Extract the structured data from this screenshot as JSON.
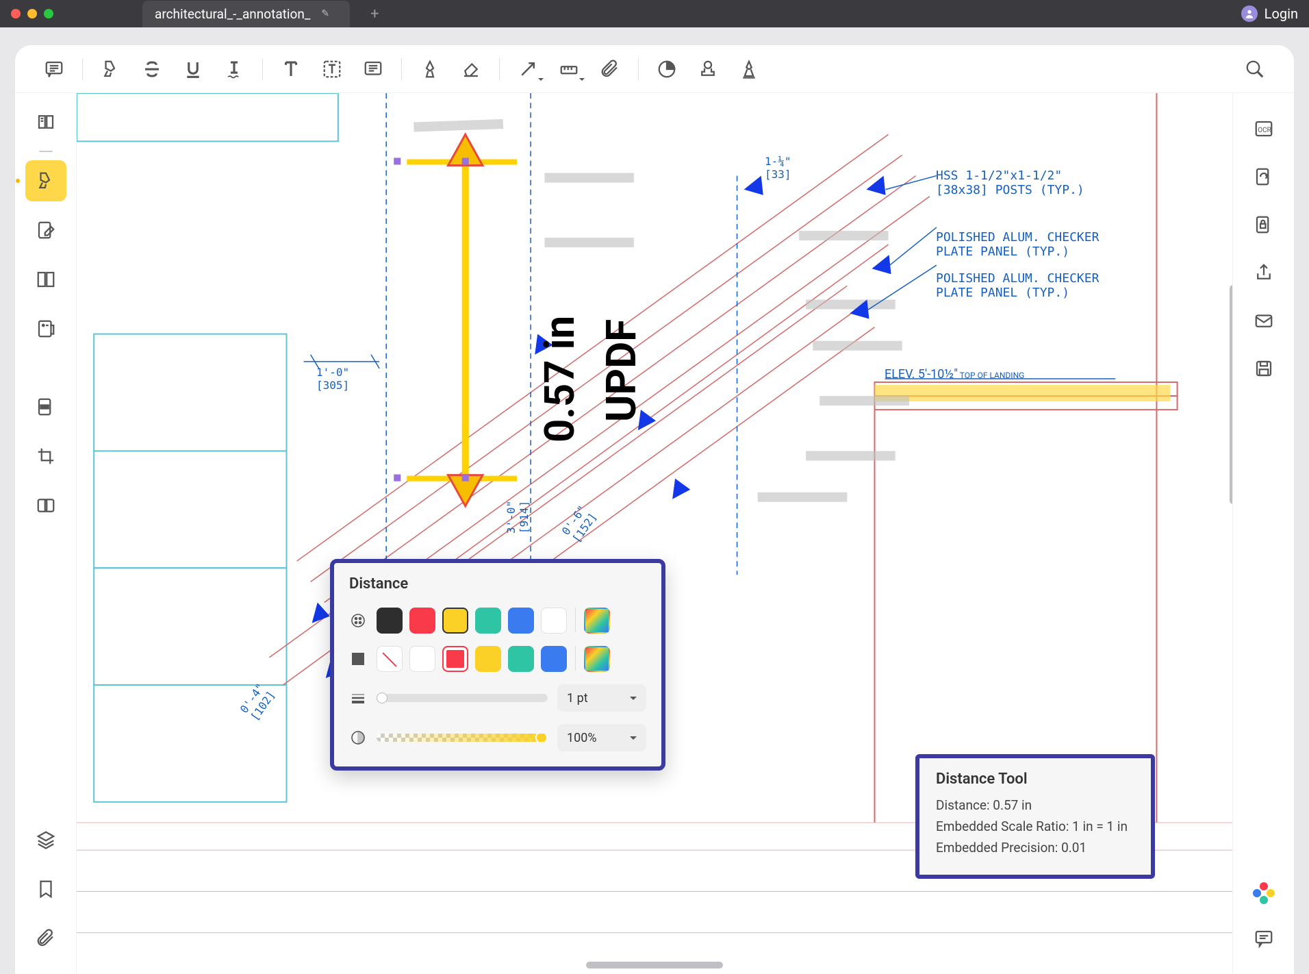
{
  "chrome": {
    "tab_title": "architectural_-_annotation_",
    "login": "Login"
  },
  "measurement": {
    "app_label": "UPDF",
    "value_label": "0.57 in"
  },
  "distance_panel": {
    "title": "Distance",
    "thickness_label": "1 pt",
    "opacity_label": "100%",
    "stroke_colors": [
      "#2e2e2e",
      "#f93a4a",
      "#fbd127",
      "#2ec4a4",
      "#3a7bf0",
      "#ffffff"
    ],
    "fill_colors": [
      "none",
      "#ffffff",
      "#f93a4a",
      "#fbd127",
      "#2ec4a4",
      "#3a7bf0"
    ]
  },
  "info_panel": {
    "title": "Distance Tool",
    "distance_line": "Distance: 0.57 in",
    "scale_line": "Embedded Scale Ratio: 1 in = 1 in",
    "precision_line": "Embedded Precision: 0.01"
  },
  "callouts": {
    "hss": "HSS 1-1/2\"x1-1/2\"\n[38x38] POSTS (TYP.)",
    "plate1": "POLISHED ALUM. CHECKER\nPLATE PANEL (TYP.)",
    "plate2": "POLISHED ALUM. CHECKER\nPLATE PANEL (TYP.)",
    "elev": "ELEV. 5'-10½\"",
    "elev_sub": " TOP OF LANDING",
    "dim_1_0": "1'-0\"\n[305]",
    "dim_0_4": "0'-4\"\n[102]",
    "dim_3_0": "3'-0\"\n[914]",
    "dim_0_6": "0'-6\"\n[152]",
    "dim_1_14": "1-¼\"\n[33]"
  }
}
